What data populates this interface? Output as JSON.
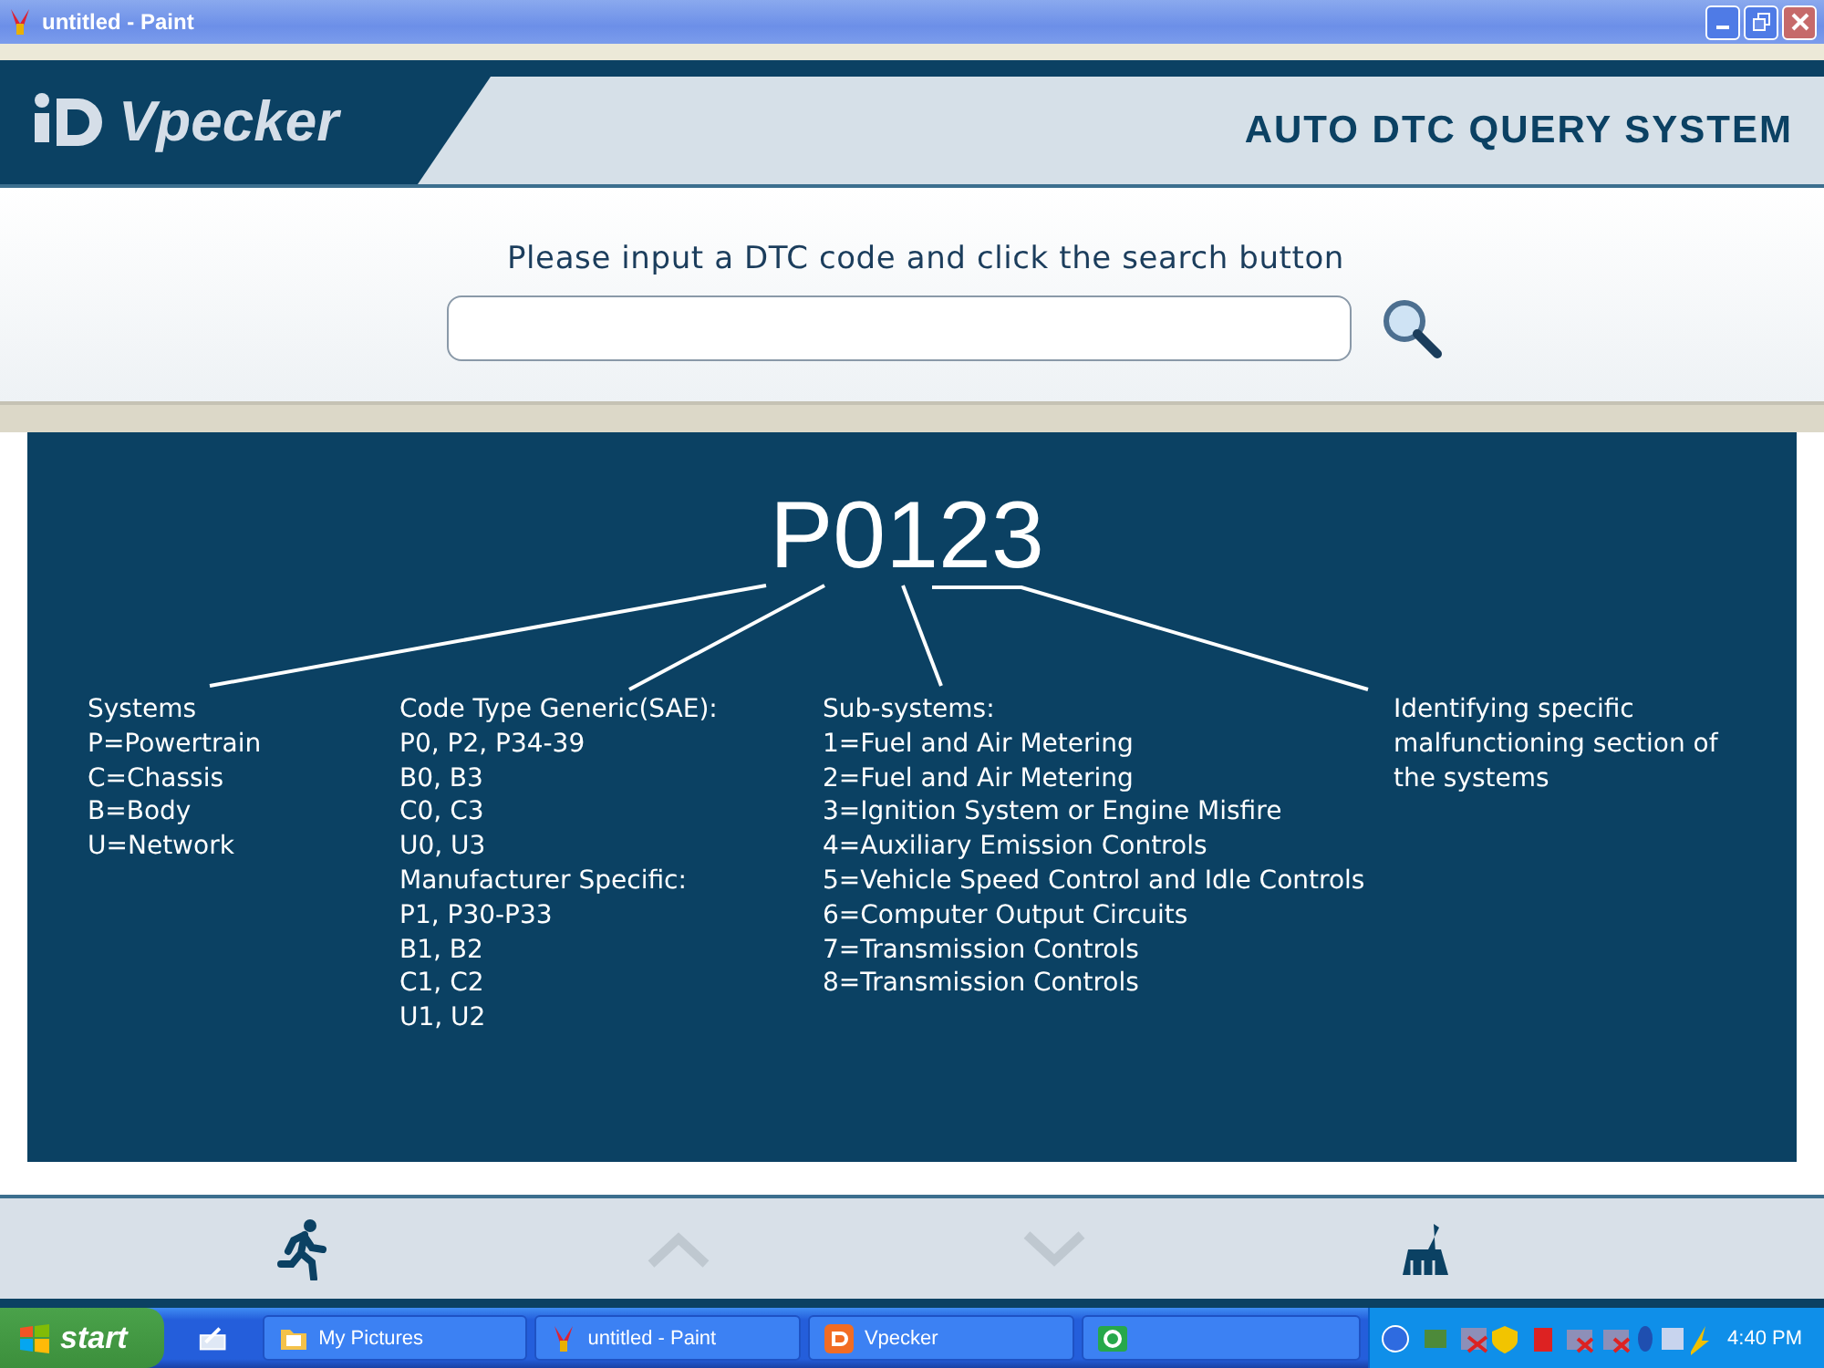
{
  "window": {
    "title": "untitled - Paint"
  },
  "header": {
    "brand": "Vpecker",
    "title": "AUTO DTC QUERY SYSTEM"
  },
  "search": {
    "prompt": "Please input a DTC code and click the search button"
  },
  "diagram": {
    "code": "P0123",
    "columns": [
      {
        "lines": [
          "Systems",
          "P=Powertrain",
          "C=Chassis",
          "B=Body",
          "U=Network"
        ]
      },
      {
        "lines": [
          "Code Type Generic(SAE):",
          "P0, P2, P34-39",
          "B0, B3",
          "C0, C3",
          "U0, U3",
          "Manufacturer Specific:",
          "P1, P30-P33",
          "B1, B2",
          "C1, C2",
          "U1, U2"
        ]
      },
      {
        "lines": [
          "Sub-systems:",
          "1=Fuel and Air Metering",
          "2=Fuel and Air Metering",
          "3=Ignition System or Engine Misfire",
          "4=Auxiliary Emission Controls",
          "5=Vehicle Speed Control and Idle Controls",
          "6=Computer Output Circuits",
          "7=Transmission Controls",
          "8=Transmission Controls"
        ]
      },
      {
        "lines": [
          "Identifying specific malfunctioning section of the systems"
        ]
      }
    ]
  },
  "toolbar": [
    {
      "kind": "exit",
      "disabled": false
    },
    {
      "kind": "up",
      "disabled": true
    },
    {
      "kind": "down",
      "disabled": true
    },
    {
      "kind": "clear",
      "disabled": false
    }
  ],
  "taskbar": {
    "start": "start",
    "tasks": [
      {
        "label": "My Pictures",
        "kind": "folder"
      },
      {
        "label": "untitled - Paint",
        "kind": "paint"
      },
      {
        "label": "Vpecker",
        "kind": "vpecker"
      },
      {
        "kind": "green"
      }
    ],
    "clock": "4:40 PM"
  }
}
